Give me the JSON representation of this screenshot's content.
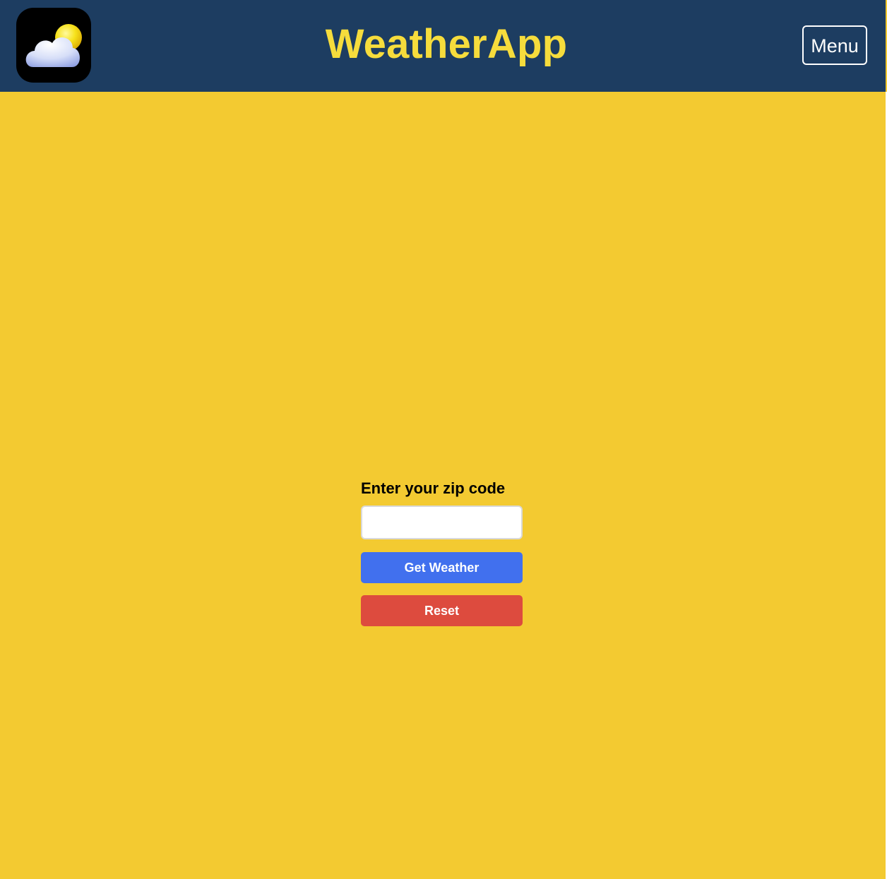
{
  "header": {
    "title": "WeatherApp",
    "menu_label": "Menu",
    "logo_icon": "partly-cloudy-icon",
    "background_color": "#1d3d61",
    "title_color": "#f6dc3c"
  },
  "page": {
    "background_color": "#f3ca31"
  },
  "form": {
    "zip_label": "Enter your zip code",
    "zip_value": "",
    "zip_placeholder": "",
    "get_weather_label": "Get Weather",
    "reset_label": "Reset",
    "get_weather_color": "#4170ee",
    "reset_color": "#dd4b3e"
  }
}
